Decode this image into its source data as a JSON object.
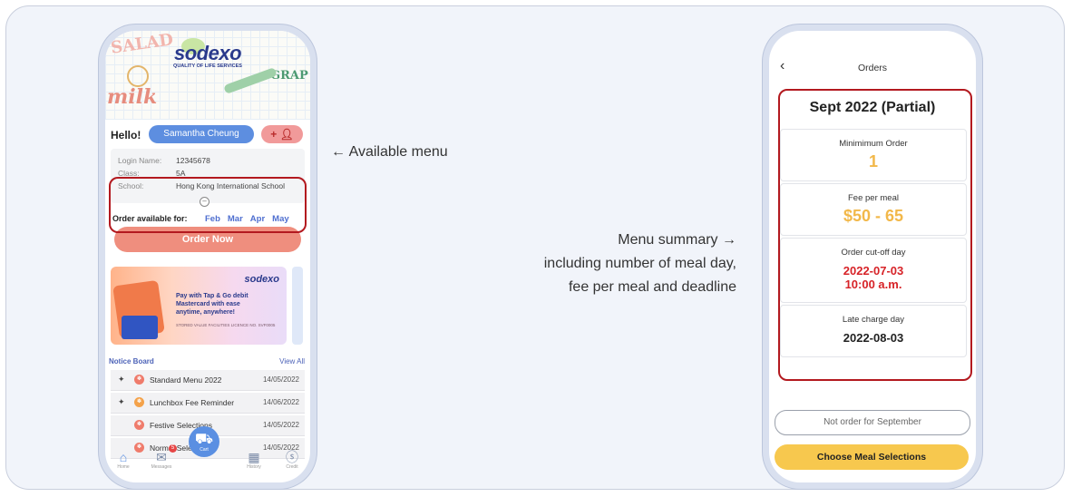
{
  "phone1": {
    "hero": {
      "brand": "sodexo",
      "tagline": "QUALITY OF LIFE SERVICES",
      "doodles": [
        "SALAD",
        "milk",
        "GRAP"
      ]
    },
    "greeting": "Hello!",
    "user_name": "Samantha Cheung",
    "add_child_label": "+ 𐀀",
    "info": {
      "login_label": "Login Name:",
      "login_value": "12345678",
      "class_label": "Class:",
      "class_value": "5A",
      "school_label": "School:",
      "school_value": "Hong Kong International School"
    },
    "order_available_label": "Order available for:",
    "months": [
      "Feb",
      "Mar",
      "Apr",
      "May"
    ],
    "order_now": "Order Now",
    "banner": {
      "logo": "sodexo",
      "line1": "Pay with Tap & Go debit",
      "line2": "Mastercard with ease",
      "line3": "anytime, anywhere!",
      "license": "STORED VALUE FACILITIES LICENCE NO. SVF0005"
    },
    "notice_board": {
      "title": "Notice Board",
      "view_all": "View All",
      "items": [
        {
          "title": "Standard Menu 2022",
          "date": "14/05/2022",
          "pinned": true
        },
        {
          "title": "Lunchbox Fee Reminder",
          "date": "14/06/2022",
          "pinned": true
        },
        {
          "title": "Festive Selections",
          "date": "14/05/2022",
          "pinned": false
        },
        {
          "title": "Normal Selections",
          "date": "14/05/2022",
          "pinned": false
        }
      ]
    },
    "tabs": {
      "home": "Home",
      "messages": "Messages",
      "cart": "Cart",
      "history": "History",
      "credit": "Credit"
    },
    "messages_badge": "5"
  },
  "phone2": {
    "title": "Orders",
    "summary_title": "Sept 2022 (Partial)",
    "cards": [
      {
        "label": "Minimimum Order",
        "value": "1",
        "color": "#f2b84a"
      },
      {
        "label": "Fee per meal",
        "value": "$50 - 65",
        "color": "#f2b84a"
      },
      {
        "label": "Order cut-off day",
        "value": "2022-07-03",
        "value2": "10:00 a.m.",
        "color": "#d72328"
      },
      {
        "label": "Late charge day",
        "value": "2022-08-03",
        "color": "#222222"
      }
    ],
    "not_order": "Not order for September",
    "choose": "Choose Meal Selections"
  },
  "annotations": {
    "available_menu": "← Available menu",
    "menu_summary": "Menu summary →",
    "menu_summary_detail1": "including number of meal day,",
    "menu_summary_detail2": "fee per meal and deadline"
  }
}
